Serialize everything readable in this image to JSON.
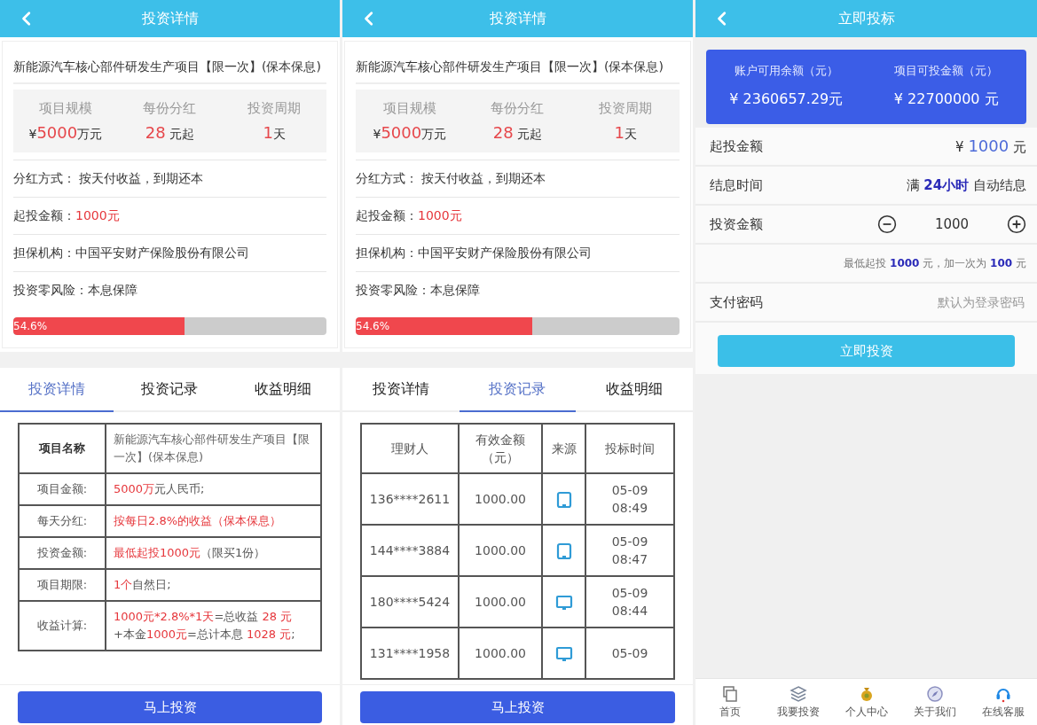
{
  "panels": [
    {
      "kind": "detail",
      "header": {
        "title": "投资详情"
      },
      "project": {
        "title": "新能源汽车核心部件研发生产项目【限一次】(保本保息)",
        "stats": [
          {
            "label": "项目规模",
            "value": [
              {
                "text": "¥",
                "highlight": false
              },
              {
                "text": "5000",
                "highlight": true
              },
              {
                "text": "万元",
                "highlight": false
              }
            ]
          },
          {
            "label": "每份分红",
            "value": [
              {
                "text": "28",
                "highlight": true
              },
              {
                "text": " 元起",
                "highlight": false
              }
            ]
          },
          {
            "label": "投资周期",
            "value": [
              {
                "text": "1",
                "highlight": true
              },
              {
                "text": "天",
                "highlight": false
              }
            ]
          }
        ],
        "info": [
          {
            "label": "分红方式：",
            "value": [
              {
                "text": " 按天付收益，到期还本",
                "highlight": false
              }
            ]
          },
          {
            "label": "起投金额：",
            "value": [
              {
                "text": "1000元",
                "highlight": true
              }
            ]
          },
          {
            "label": "担保机构：",
            "value": [
              {
                "text": "中国平安财产保险股份有限公司",
                "highlight": false
              }
            ]
          },
          {
            "label": "投资零风险：",
            "value": [
              {
                "text": "本息保障",
                "highlight": false
              }
            ]
          }
        ],
        "progress": {
          "level": 0.546,
          "label": "54.6%"
        }
      },
      "tabs": [
        {
          "label": "投资详情",
          "selected": true
        },
        {
          "label": "投资记录",
          "selected": false
        },
        {
          "label": "收益明细",
          "selected": false
        }
      ],
      "detail_table": [
        {
          "kind": "name",
          "label": "项目名称",
          "value": [
            {
              "text": "新能源汽车核心部件研发生产项目【限一次】(保本保息)",
              "highlight": false
            }
          ]
        },
        {
          "kind": "field",
          "label": "项目金额:",
          "value": [
            {
              "text": "5000万",
              "highlight": true
            },
            {
              "text": "元人民币;",
              "highlight": false
            }
          ]
        },
        {
          "kind": "field",
          "label": "每天分红:",
          "value": [
            {
              "text": "按每日2.8%的收益（保本保息）",
              "highlight": true
            }
          ]
        },
        {
          "kind": "field",
          "label": "投资金额:",
          "value": [
            {
              "text": "最低起投1000元",
              "highlight": true
            },
            {
              "text": "（限买1份）",
              "highlight": false
            }
          ]
        },
        {
          "kind": "field",
          "label": "项目期限:",
          "value": [
            {
              "text": "1个",
              "highlight": true
            },
            {
              "text": "自然日;",
              "highlight": false
            }
          ]
        },
        {
          "kind": "field",
          "label": "收益计算:",
          "value": [
            {
              "text": "1000元*2.8%*1天",
              "highlight": true
            },
            {
              "text": "=总收益 ",
              "highlight": false
            },
            {
              "text": "28 元",
              "highlight": true
            },
            {
              "text": " +本金",
              "highlight": false
            },
            {
              "text": "1000元",
              "highlight": true
            },
            {
              "text": "=总计本息 ",
              "highlight": false
            },
            {
              "text": "1028 元",
              "highlight": true
            },
            {
              "text": ";",
              "highlight": false
            }
          ]
        }
      ],
      "action_button": "马上投资"
    },
    {
      "kind": "records",
      "header": {
        "title": "投资详情"
      },
      "project": {
        "title": "新能源汽车核心部件研发生产项目【限一次】(保本保息)",
        "stats": [
          {
            "label": "项目规模",
            "value": [
              {
                "text": "¥",
                "highlight": false
              },
              {
                "text": "5000",
                "highlight": true
              },
              {
                "text": "万元",
                "highlight": false
              }
            ]
          },
          {
            "label": "每份分红",
            "value": [
              {
                "text": "28",
                "highlight": true
              },
              {
                "text": " 元起",
                "highlight": false
              }
            ]
          },
          {
            "label": "投资周期",
            "value": [
              {
                "text": "1",
                "highlight": true
              },
              {
                "text": "天",
                "highlight": false
              }
            ]
          }
        ],
        "info": [
          {
            "label": "分红方式：",
            "value": [
              {
                "text": " 按天付收益，到期还本",
                "highlight": false
              }
            ]
          },
          {
            "label": "起投金额：",
            "value": [
              {
                "text": "1000元",
                "highlight": true
              }
            ]
          },
          {
            "label": "担保机构：",
            "value": [
              {
                "text": "中国平安财产保险股份有限公司",
                "highlight": false
              }
            ]
          },
          {
            "label": "投资零风险：",
            "value": [
              {
                "text": "本息保障",
                "highlight": false
              }
            ]
          }
        ],
        "progress": {
          "level": 0.546,
          "label": "54.6%"
        }
      },
      "tabs": [
        {
          "label": "投资详情",
          "selected": false
        },
        {
          "label": "投资记录",
          "selected": true
        },
        {
          "label": "收益明细",
          "selected": false
        }
      ],
      "records_table": {
        "columns": [
          "理财人",
          "有效金额（元）",
          "来源",
          "投标时间"
        ],
        "rows": [
          {
            "investor": "136****2611",
            "amount": "1000.00",
            "kind": "tablet",
            "time": "05-09 08:49"
          },
          {
            "investor": "144****3884",
            "amount": "1000.00",
            "kind": "tablet",
            "time": "05-09 08:47"
          },
          {
            "investor": "180****5424",
            "amount": "1000.00",
            "kind": "desktop",
            "time": "05-09 08:44"
          },
          {
            "investor": "131****1958",
            "amount": "1000.00",
            "kind": "desktop",
            "time": "05-09"
          }
        ]
      },
      "action_button": "马上投资"
    },
    {
      "kind": "invest",
      "header": {
        "title": "立即投标"
      },
      "balances": [
        {
          "label": "账户可用余额（元）",
          "value": "¥ 2360657.29元"
        },
        {
          "label": "项目可投金额（元）",
          "value": "¥ 22700000 元"
        }
      ],
      "min_amount": {
        "label": "起投金额",
        "value": [
          {
            "text": "¥ ",
            "highlight": false
          },
          {
            "text": "1000",
            "highlight": true
          },
          {
            "text": " 元",
            "highlight": false
          }
        ]
      },
      "interest_time": {
        "label": "结息时间",
        "value": "满 **24小时** 自动结息"
      },
      "amount": {
        "label": "投资金额",
        "value": "1000"
      },
      "hint": "最低起投 **1000** 元，加一次为 **100** 元",
      "password": {
        "label": "支付密码",
        "placeholder": "默认为登录密码"
      },
      "submit_button": "立即投资",
      "tab_bar": [
        {
          "kind": "home",
          "label": "首页"
        },
        {
          "kind": "layers",
          "label": "我要投资"
        },
        {
          "kind": "moneybag",
          "label": "个人中心"
        },
        {
          "kind": "compass",
          "label": "关于我们"
        },
        {
          "kind": "headset",
          "label": "在线客服"
        }
      ]
    }
  ]
}
